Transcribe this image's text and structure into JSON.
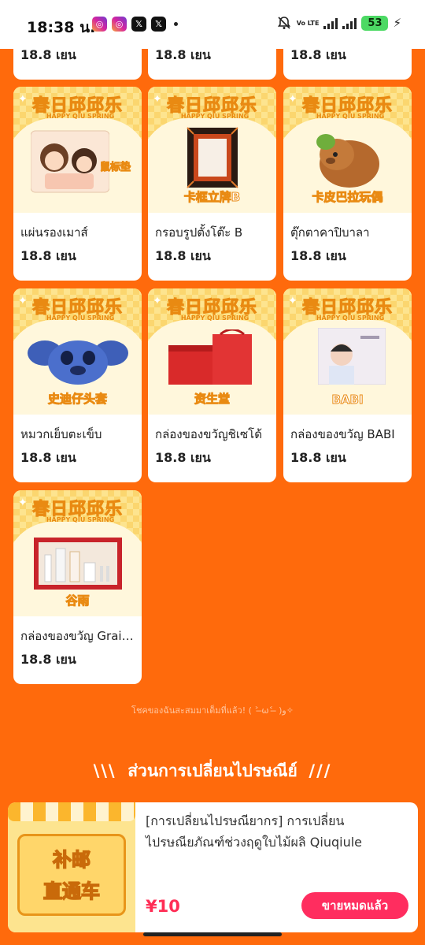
{
  "status": {
    "time": "18:38 น.",
    "network": "Vo LTE",
    "network_5g": "5G",
    "battery": "53"
  },
  "top_row": [
    {
      "price": "18.8 เยน"
    },
    {
      "price": "18.8 เยน"
    },
    {
      "price": "18.8 เยน"
    }
  ],
  "banner": {
    "title": "春日邱邱乐",
    "subtitle": "HAPPY QIU SPRING"
  },
  "products": [
    {
      "name": "แผ่นรองเมาส์",
      "price": "18.8 เยน",
      "caption": "鼠标垫"
    },
    {
      "name": "กรอบรูปตั้งโต๊ะ B",
      "price": "18.8 เยน",
      "caption": "卡框立牌B"
    },
    {
      "name": "ตุ๊กตาคาปิบาลา",
      "price": "18.8 เยน",
      "caption": "卡皮巴拉玩偶"
    },
    {
      "name": "หมวกเย็บตะเข็บ",
      "price": "18.8 เยน",
      "caption": "史迪仔头套"
    },
    {
      "name": "กล่องของขวัญชิเซโด้",
      "price": "18.8 เยน",
      "caption": "资生堂"
    },
    {
      "name": "กล่องของขวัญ BABI",
      "price": "18.8 เยน",
      "caption": "BABI"
    },
    {
      "name": "กล่องของขวัญ Grain Rain",
      "price": "18.8 เยน",
      "caption": "谷雨"
    }
  ],
  "footer_note": "โชคของฉันสะสมมาเต็มที่แล้ว! ( ˃ ̶ω˂ ̶ )و✧",
  "section": {
    "slash_left": "\\\\\\",
    "title": "ส่วนการเปลี่ยนไปรษณีย์",
    "slash_right": "///"
  },
  "exchange": {
    "thumb_line1": "补邮",
    "thumb_line2": "直通车",
    "title": "[การเปลี่ยนไปรษณียากร] การเปลี่ยนไปรษณียภัณฑ์ช่วงฤดูใบไม้ผลิ Qiuqiule",
    "price": "¥10",
    "button": "ขายหมดแล้ว"
  },
  "colors": {
    "accent": "#ff6a0c",
    "sale_red": "#ff2d55"
  }
}
